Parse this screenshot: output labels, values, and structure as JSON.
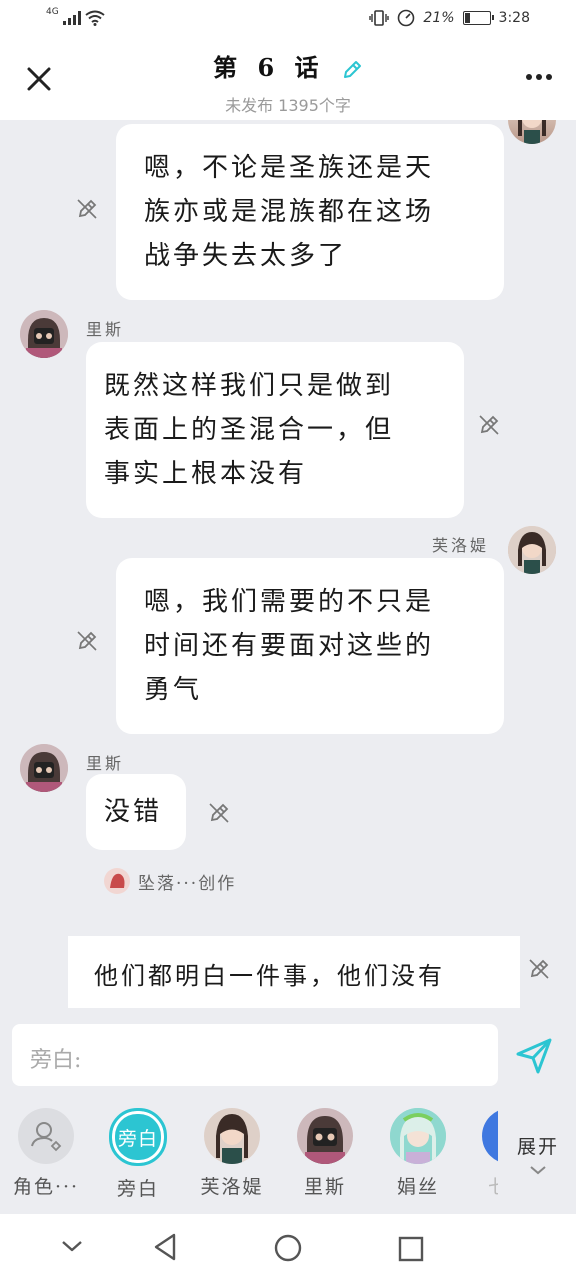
{
  "status": {
    "network": "4G",
    "battery": "21%",
    "time": "3:28"
  },
  "header": {
    "title": "第 6 话",
    "subtitle": "未发布 1395个字"
  },
  "messages": [
    {
      "text_lines": [
        "嗯，不论是圣族还是天",
        "族亦或是混族都在这场",
        "战争失去太多了"
      ]
    },
    {
      "speaker": "里斯",
      "text_lines": [
        "既然这样我们只是做到",
        "表面上的圣混合一，但",
        "事实上根本没有"
      ]
    },
    {
      "speaker": "芙洛媞",
      "text_lines": [
        "嗯，我们需要的不只是",
        "时间还有要面对这些的",
        "勇气"
      ]
    },
    {
      "speaker": "里斯",
      "text_lines": [
        "没错"
      ]
    },
    {
      "author_tag": "坠落···创作"
    },
    {
      "text_lines": [
        "他们都明白一件事，他们没有"
      ]
    }
  ],
  "input": {
    "placeholder": "旁白:"
  },
  "roles": [
    {
      "label": "角色···"
    },
    {
      "label": "旁白",
      "circle_text": "旁白"
    },
    {
      "label": "芙洛媞"
    },
    {
      "label": "里斯"
    },
    {
      "label": "娟丝"
    },
    {
      "label": "七"
    }
  ],
  "expand_label": "展开",
  "colors": {
    "accent": "#2CC5D2",
    "background": "#ECEDF1",
    "bubble": "#FFFFFF"
  }
}
